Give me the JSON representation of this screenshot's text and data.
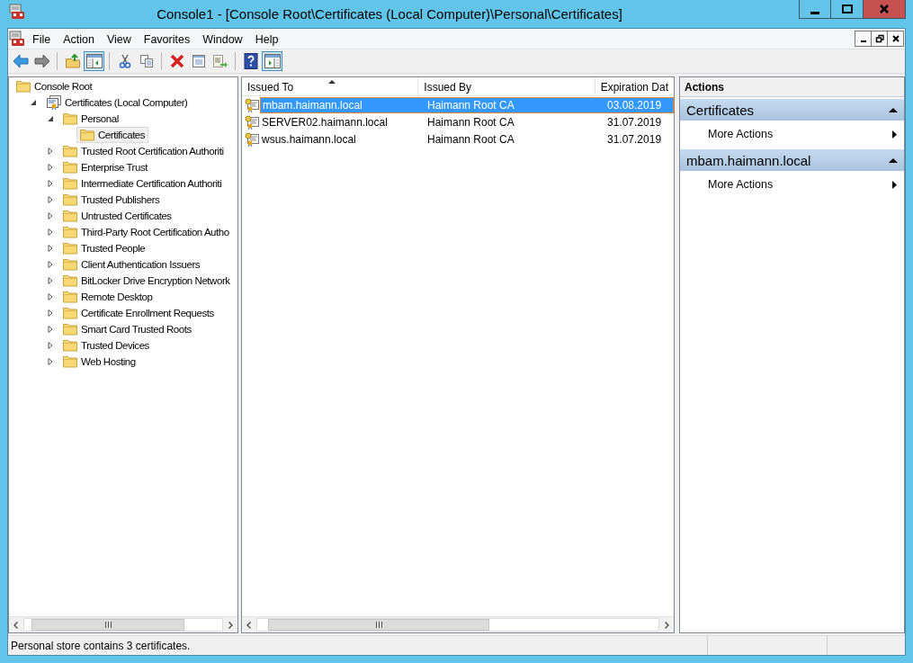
{
  "window": {
    "title": "Console1 - [Console Root\\Certificates (Local Computer)\\Personal\\Certificates]"
  },
  "menu": [
    {
      "label": "File"
    },
    {
      "label": "Action"
    },
    {
      "label": "View"
    },
    {
      "label": "Favorites"
    },
    {
      "label": "Window"
    },
    {
      "label": "Help"
    }
  ],
  "toolbar": [
    {
      "kind": "back",
      "pressed": false
    },
    {
      "kind": "forward",
      "pressed": false
    },
    {
      "kind": "sep"
    },
    {
      "kind": "up",
      "pressed": false
    },
    {
      "kind": "tree",
      "pressed": true
    },
    {
      "kind": "sep"
    },
    {
      "kind": "cut",
      "pressed": false
    },
    {
      "kind": "copy",
      "pressed": false
    },
    {
      "kind": "sep"
    },
    {
      "kind": "delete",
      "pressed": false
    },
    {
      "kind": "properties",
      "pressed": false
    },
    {
      "kind": "export",
      "pressed": false
    },
    {
      "kind": "sep"
    },
    {
      "kind": "help",
      "pressed": false
    },
    {
      "kind": "actionpane",
      "pressed": true
    }
  ],
  "tree": [
    {
      "label": "Console Root",
      "kind": "folder",
      "selected": false,
      "children": [
        {
          "label": "Certificates (Local Computer)",
          "kind": "store",
          "expanded": true,
          "selected": false,
          "children": [
            {
              "label": "Personal",
              "kind": "folder",
              "expanded": true,
              "selected": false,
              "children": [
                {
                  "label": "Certificates",
                  "kind": "folder",
                  "selected": true
                }
              ]
            },
            {
              "label": "Trusted Root Certification Authoriti",
              "kind": "folder",
              "expanded": false,
              "selected": false
            },
            {
              "label": "Enterprise Trust",
              "kind": "folder",
              "expanded": false,
              "selected": false
            },
            {
              "label": "Intermediate Certification Authoriti",
              "kind": "folder",
              "expanded": false,
              "selected": false
            },
            {
              "label": "Trusted Publishers",
              "kind": "folder",
              "expanded": false,
              "selected": false
            },
            {
              "label": "Untrusted Certificates",
              "kind": "folder",
              "expanded": false,
              "selected": false
            },
            {
              "label": "Third-Party Root Certification Autho",
              "kind": "folder",
              "expanded": false,
              "selected": false
            },
            {
              "label": "Trusted People",
              "kind": "folder",
              "expanded": false,
              "selected": false
            },
            {
              "label": "Client Authentication Issuers",
              "kind": "folder",
              "expanded": false,
              "selected": false
            },
            {
              "label": "BitLocker Drive Encryption Network",
              "kind": "folder",
              "expanded": false,
              "selected": false
            },
            {
              "label": "Remote Desktop",
              "kind": "folder",
              "expanded": false,
              "selected": false
            },
            {
              "label": "Certificate Enrollment Requests",
              "kind": "folder",
              "expanded": false,
              "selected": false
            },
            {
              "label": "Smart Card Trusted Roots",
              "kind": "folder",
              "expanded": false,
              "selected": false
            },
            {
              "label": "Trusted Devices",
              "kind": "folder",
              "expanded": false,
              "selected": false
            },
            {
              "label": "Web Hosting",
              "kind": "folder",
              "expanded": false,
              "selected": false
            }
          ]
        }
      ]
    }
  ],
  "table": {
    "columns": [
      {
        "label": "Issued To",
        "sorted": true
      },
      {
        "label": "Issued By"
      },
      {
        "label": "Expiration Dat"
      }
    ],
    "rows": [
      {
        "selected": true,
        "cells": [
          "mbam.haimann.local",
          "Haimann Root CA",
          "03.08.2019"
        ]
      },
      {
        "selected": false,
        "cells": [
          "SERVER02.haimann.local",
          "Haimann Root CA",
          "31.07.2019"
        ]
      },
      {
        "selected": false,
        "cells": [
          "wsus.haimann.local",
          "Haimann Root CA",
          "31.07.2019"
        ]
      }
    ]
  },
  "actions": {
    "title": "Actions",
    "sections": [
      {
        "title": "Certificates",
        "expanded": true,
        "items": [
          {
            "label": "More Actions",
            "submenu": true
          }
        ]
      },
      {
        "title": "mbam.haimann.local",
        "expanded": true,
        "items": [
          {
            "label": "More Actions",
            "submenu": true
          }
        ]
      }
    ]
  },
  "status_bar": {
    "text": "Personal store contains 3 certificates."
  }
}
